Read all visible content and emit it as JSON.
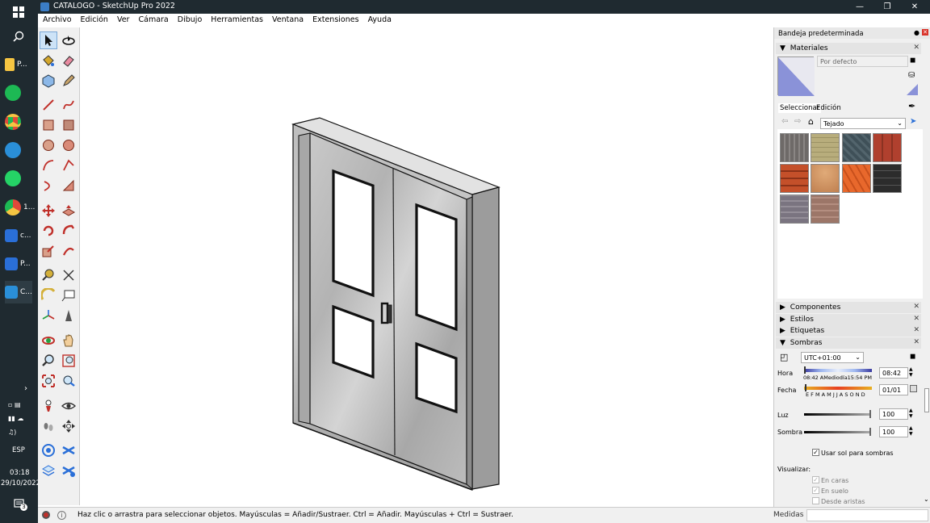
{
  "taskbar": {
    "apps": [
      {
        "label": "P...",
        "color": "#f5c542"
      },
      {
        "label": "",
        "color": "#1db954"
      },
      {
        "label": "",
        "color": "#e04a3a"
      },
      {
        "label": "",
        "color": "#2a8fd8"
      },
      {
        "label": "",
        "color": "#25d366"
      },
      {
        "label": "1...",
        "color": "#e04a3a"
      },
      {
        "label": "c...",
        "color": "#2a6fd8"
      },
      {
        "label": "P...",
        "color": "#2a6fd8"
      },
      {
        "label": "C...",
        "color": "#2a8fd8"
      }
    ],
    "language": "ESP",
    "time": "03:18",
    "date": "29/10/2022",
    "notification_count": "3"
  },
  "window": {
    "title": "CATALOGO - SketchUp Pro 2022"
  },
  "menu": {
    "items": [
      "Archivo",
      "Edición",
      "Ver",
      "Cámara",
      "Dibujo",
      "Herramientas",
      "Ventana",
      "Extensiones",
      "Ayuda"
    ]
  },
  "tray": {
    "title": "Bandeja predeterminada",
    "materials": {
      "header": "Materiales",
      "material_name": "Por defecto",
      "tab_select": "Seleccionar",
      "tab_edit": "Edición",
      "collection": "Tejado",
      "swatch_colors": [
        "#6e6a68",
        "#b8ad7c",
        "#3f5058",
        "#b0402e",
        "#c4502a",
        "#d69a66",
        "#e8682c",
        "#2c2c2c",
        "#7a7480",
        "#9c7668"
      ]
    },
    "sections": {
      "components": "Componentes",
      "styles": "Estilos",
      "tags": "Etiquetas",
      "shadows": "Sombras"
    },
    "shadows": {
      "timezone": "UTC+01:00",
      "time_label": "Hora",
      "time_scale": "08:42 AMediodía15:54 PM",
      "time_value": "08:42",
      "date_label": "Fecha",
      "date_scale": "E F M A M J J A S O N D",
      "date_value": "01/01",
      "light_label": "Luz",
      "light_value": "100",
      "dark_label": "Sombra",
      "dark_value": "100",
      "use_sun_label": "Usar sol para sombras",
      "display_label": "Visualizar:",
      "on_faces": "En caras",
      "on_ground": "En suelo",
      "from_edges": "Desde aristas"
    }
  },
  "status": {
    "hint": "Haz clic o arrastra para seleccionar objetos. Mayúsculas = Añadir/Sustraer. Ctrl = Añadir. Mayúsculas + Ctrl = Sustraer.",
    "measurements_label": "Medidas"
  }
}
